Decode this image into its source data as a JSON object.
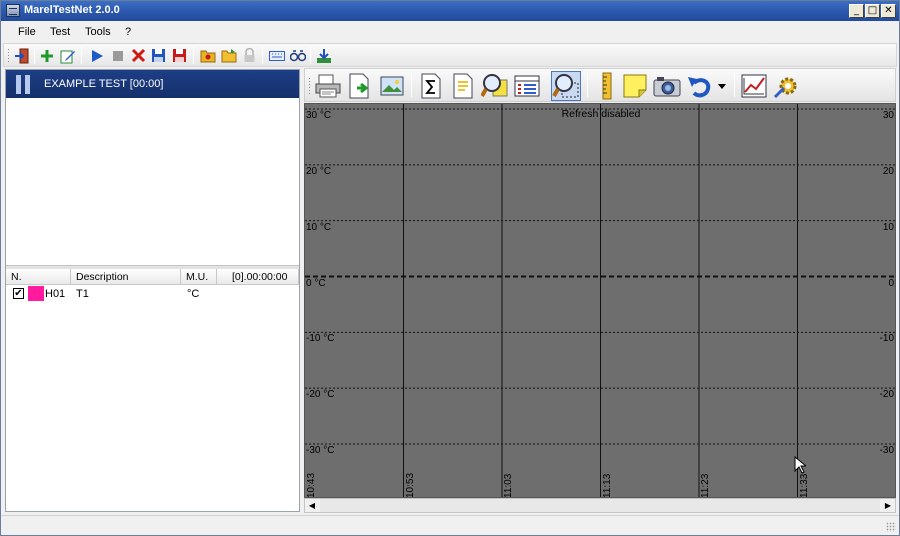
{
  "window": {
    "title": "MarelTestNet 2.0.0",
    "controls": {
      "minimize": "_",
      "maximize": "□",
      "close": "✕"
    }
  },
  "menu": [
    "File",
    "Test",
    "Tools",
    "?"
  ],
  "toolbar_top": {
    "icons": [
      "exit-icon",
      "add-icon",
      "edit-icon",
      "play-icon",
      "stop-icon",
      "delete-icon",
      "save-icon",
      "save-as-icon",
      "open-folder-icon",
      "folder-icon",
      "lock-icon",
      "keyboard-icon",
      "binoculars-icon",
      "download-icon"
    ]
  },
  "test": {
    "title": "EXAMPLE TEST [00:00]",
    "status_icon": "pause-icon"
  },
  "channel_table": {
    "headers": [
      "N.",
      "Description",
      "M.U.",
      "[0].00:00:00"
    ],
    "rows": [
      {
        "checked": "✔",
        "color": "#ff1a9e",
        "id": "H01",
        "description": "T1",
        "unit": "°C"
      }
    ]
  },
  "chart_toolbar": {
    "icons": [
      "print-icon",
      "export-icon",
      "image-icon",
      "sum-icon",
      "document-icon",
      "zoom-icon",
      "list-icon",
      "zoom-select-icon",
      "ruler-icon",
      "note-icon",
      "camera-icon",
      "undo-icon",
      "dropdown-arrow-icon",
      "chart-icon",
      "settings-icon"
    ]
  },
  "chart_data": {
    "type": "line",
    "notice": "Refresh disabled",
    "background": "#6e6e6e",
    "y_ticks_left": [
      "30 °C",
      "20 °C",
      "10 °C",
      "0 °C",
      "-10 °C",
      "-20 °C",
      "-30 °C"
    ],
    "y_ticks_right": [
      "30",
      "20",
      "10",
      "0",
      "-10",
      "-20",
      "-30"
    ],
    "y_values": [
      30,
      20,
      10,
      0,
      -10,
      -20,
      -30
    ],
    "ylim": [
      -30,
      30
    ],
    "x_ticks": [
      "10:43",
      "10:53",
      "11:03",
      "11:13",
      "11:23",
      "11:33"
    ],
    "grid": true,
    "series": []
  },
  "scrollbar": {
    "left_arrow": "◀",
    "right_arrow": "▶"
  }
}
